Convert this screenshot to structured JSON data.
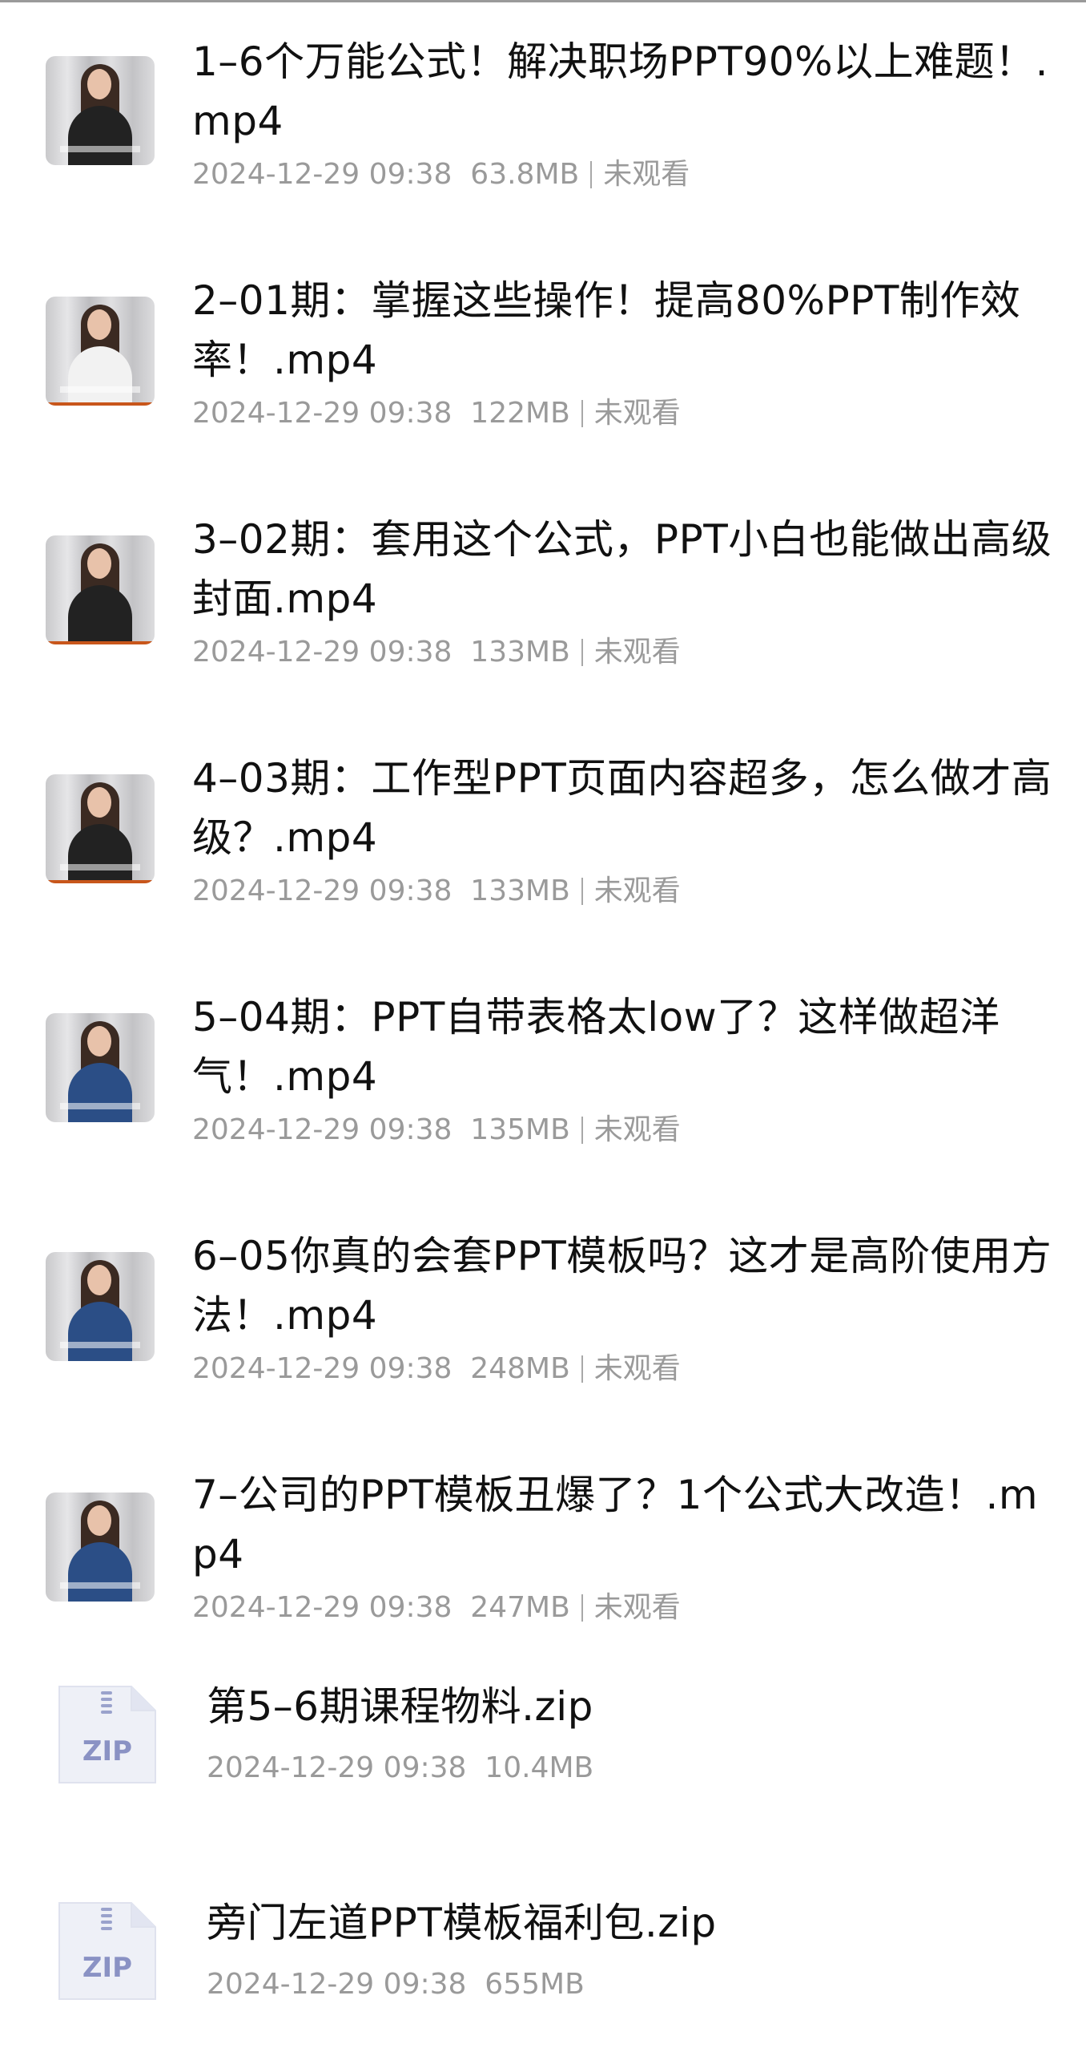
{
  "files": [
    {
      "title": "1–6个万能公式！解决职场PPT90%以上难题！.mp4",
      "date": "2024-12-29 09:38",
      "size": "63.8MB",
      "status": "未观看",
      "outfit": "black-white"
    },
    {
      "title": "2–01期：掌握这些操作！提高80%PPT制作效率！.mp4",
      "date": "2024-12-29 09:38",
      "size": "122MB",
      "status": "未观看",
      "outfit": "white"
    },
    {
      "title": "3–02期：套用这个公式，PPT小白也能做出高级封面.mp4",
      "date": "2024-12-29 09:38",
      "size": "133MB",
      "status": "未观看",
      "outfit": "black"
    },
    {
      "title": "4–03期：工作型PPT页面内容超多，怎么做才高级？.mp4",
      "date": "2024-12-29 09:38",
      "size": "133MB",
      "status": "未观看",
      "outfit": "black"
    },
    {
      "title": "5–04期：PPT自带表格太low了？这样做超洋气！.mp4",
      "date": "2024-12-29 09:38",
      "size": "135MB",
      "status": "未观看",
      "outfit": "blue"
    },
    {
      "title": "6–05你真的会套PPT模板吗？这才是高阶使用方法！.mp4",
      "date": "2024-12-29 09:38",
      "size": "248MB",
      "status": "未观看",
      "outfit": "blue"
    },
    {
      "title": "7–公司的PPT模板丑爆了？1个公式大改造！.mp4",
      "date": "2024-12-29 09:38",
      "size": "247MB",
      "status": "未观看",
      "outfit": "blue"
    }
  ],
  "zips": [
    {
      "title": "第5–6期课程物料.zip",
      "date": "2024-12-29 09:38",
      "size": "10.4MB",
      "icon_label": "ZIP",
      "icon": "zip-file-icon"
    },
    {
      "title": "旁门左道PPT模板福利包.zip",
      "date": "2024-12-29 09:38",
      "size": "655MB",
      "icon_label": "ZIP",
      "icon": "zip-file-icon"
    }
  ],
  "colors": {
    "title": "#111111",
    "meta": "#9a9a9a",
    "zip_icon_bg": "#eef0f7",
    "zip_label": "#8a92c4"
  }
}
